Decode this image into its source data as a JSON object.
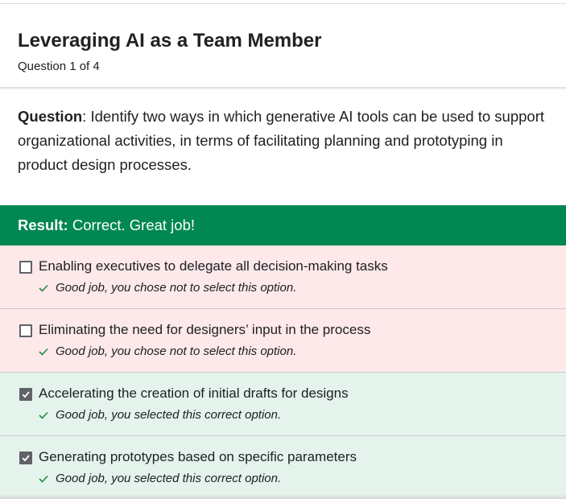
{
  "header": {
    "title": "Leveraging AI as a Team Member",
    "progress": "Question 1 of 4"
  },
  "question": {
    "label": "Question",
    "text": ": Identify two ways in which generative AI tools can be used to support organizational activities, in terms of facilitating planning and prototyping in product design processes."
  },
  "result": {
    "label": "Result:",
    "text": " Correct. Great job!",
    "color": "#008752"
  },
  "options": [
    {
      "label": "Enabling executives to delegate all decision-making tasks",
      "feedback": "Good job, you chose not to select this option.",
      "selected": false,
      "status": "incorrect-option"
    },
    {
      "label": "Eliminating the need for designers’ input in the process",
      "feedback": "Good job, you chose not to select this option.",
      "selected": false,
      "status": "incorrect-option"
    },
    {
      "label": "Accelerating the creation of initial drafts for designs",
      "feedback": "Good job, you selected this correct option.",
      "selected": true,
      "status": "correct-option"
    },
    {
      "label": "Generating prototypes based on specific parameters",
      "feedback": "Good job, you selected this correct option.",
      "selected": true,
      "status": "correct-option"
    }
  ],
  "colors": {
    "incorrect_bg": "#fde8ea",
    "correct_bg": "#e4f3ec",
    "check_green": "#1e8e3e"
  },
  "icons": {
    "checkbox_checked": "checkbox-checked-icon",
    "checkbox_empty": "checkbox-empty-icon",
    "feedback": "checkmark-icon"
  }
}
